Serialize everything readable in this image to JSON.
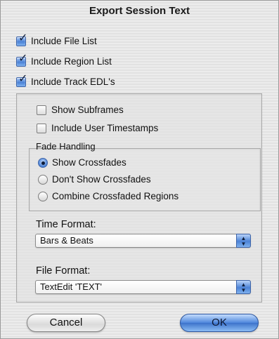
{
  "dialog": {
    "title": "Export Session Text"
  },
  "options": {
    "include_file_list": {
      "label": "Include File List",
      "checked": true
    },
    "include_region_list": {
      "label": "Include Region List",
      "checked": true
    },
    "include_track_edls": {
      "label": "Include Track EDL's",
      "checked": true
    }
  },
  "track_options": {
    "show_subframes": {
      "label": "Show Subframes",
      "checked": false
    },
    "include_user_timestamps": {
      "label": "Include User Timestamps",
      "checked": false
    }
  },
  "fade_handling": {
    "title": "Fade Handling",
    "options": [
      {
        "label": "Show Crossfades",
        "selected": true
      },
      {
        "label": "Don't Show Crossfades",
        "selected": false
      },
      {
        "label": "Combine Crossfaded Regions",
        "selected": false
      }
    ]
  },
  "time_format": {
    "label": "Time Format:",
    "value": "Bars & Beats"
  },
  "file_format": {
    "label": "File Format:",
    "value": "TextEdit 'TEXT'"
  },
  "buttons": {
    "cancel": "Cancel",
    "ok": "OK"
  },
  "colors": {
    "accent": "#4b82d6"
  }
}
